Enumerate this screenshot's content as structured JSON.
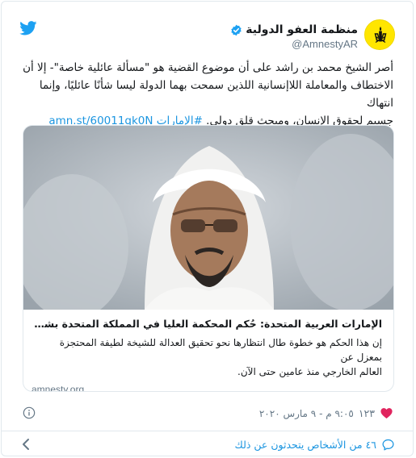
{
  "account": {
    "display_name": "منظمة العفو الدولية",
    "handle": "@AmnestyAR"
  },
  "tweet": {
    "line1": "أصر الشيخ محمد بن راشد على أن موضوع القضية هو \"مسألة عائلية خاصة\"- إلا أن",
    "line2": "الاختطاف والمعاملة اللاإنسانية اللذين سمحت بهما الدولة ليسا شأنًا عائليًا، وإنما انتهاك",
    "line3_text": "جسيم لحقوق الإنسان، ومبحث قلق دولي. ",
    "hashtag": "#الإمارات",
    "link": "amn.st/60011qk0N"
  },
  "card": {
    "title": "الإمارات العربية المتحدة: حُكم المحكمة العليا في المملكة المتحدة بشأن احتجاز حاكم دبي لابنته",
    "desc_line1": "إن هذا الحكم هو خطوة طال انتظارها نحو تحقيق العدالة للشيخة لطيفة المحتجزة بمعزل عن",
    "desc_line2": "العالم الخارجي منذ عامين حتى الآن.",
    "domain": "amnesty.org"
  },
  "meta": {
    "likes": "١٢٣",
    "timestamp": "٩:٠٥ م - ٩ مارس ٢٠٢٠"
  },
  "footer": {
    "people_talking": "٤٦ من الأشخاص يتحدثون عن ذلك"
  },
  "colors": {
    "brand_yellow": "#ffe600",
    "twitter_blue": "#1da1f2",
    "link_blue": "#1b95e0",
    "muted": "#657786",
    "border": "#e1e8ed"
  },
  "icons": [
    "amnesty-candle-logo",
    "verified-badge-icon",
    "twitter-bird-icon",
    "heart-icon",
    "info-icon",
    "speech-bubble-icon",
    "chevron-left-icon"
  ]
}
